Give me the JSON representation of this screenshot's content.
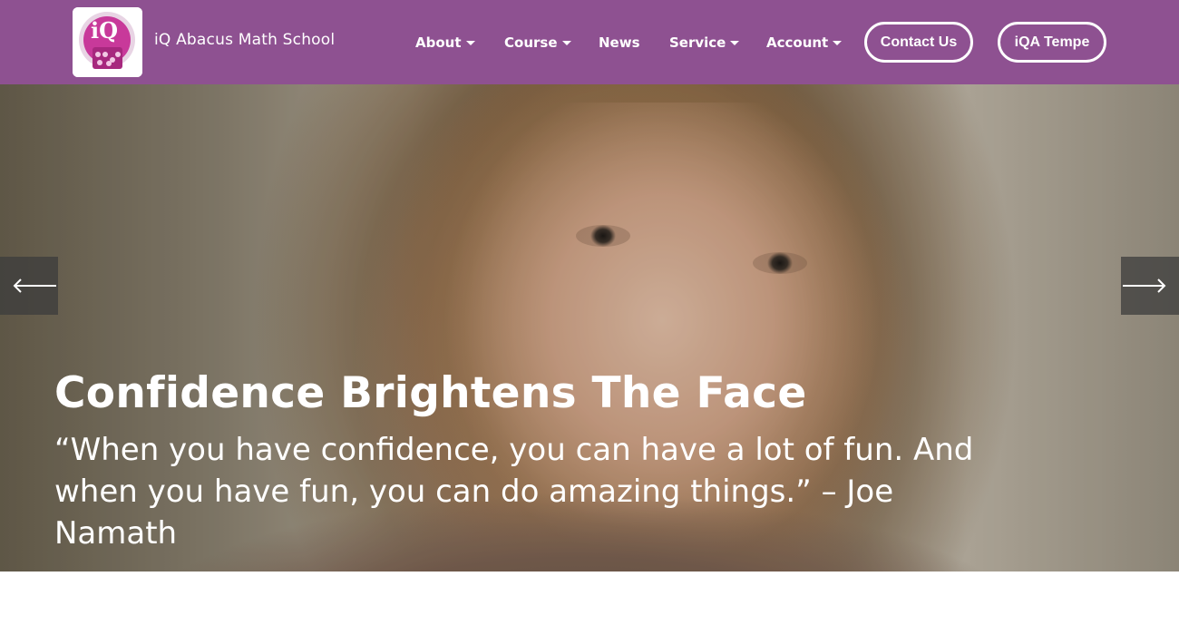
{
  "header": {
    "brand_name": "iQ Abacus Math School",
    "logo_icon": "iq-abacus-logo",
    "background_color": "#8e5191",
    "nav": [
      {
        "label": "About",
        "has_dropdown": true
      },
      {
        "label": "Course",
        "has_dropdown": true
      },
      {
        "label": "News",
        "has_dropdown": false
      },
      {
        "label": "Service",
        "has_dropdown": true
      },
      {
        "label": "Account",
        "has_dropdown": true
      }
    ],
    "buttons": {
      "contact": "Contact Us",
      "location": "iQA Tempe"
    }
  },
  "hero": {
    "title": "Confidence Brightens The Face",
    "quote": "“When you have confidence, you can have a lot of fun. And when you have fun, you can do amazing things.” – Joe Namath",
    "prev_icon": "arrow-left-icon",
    "next_icon": "arrow-right-icon"
  }
}
